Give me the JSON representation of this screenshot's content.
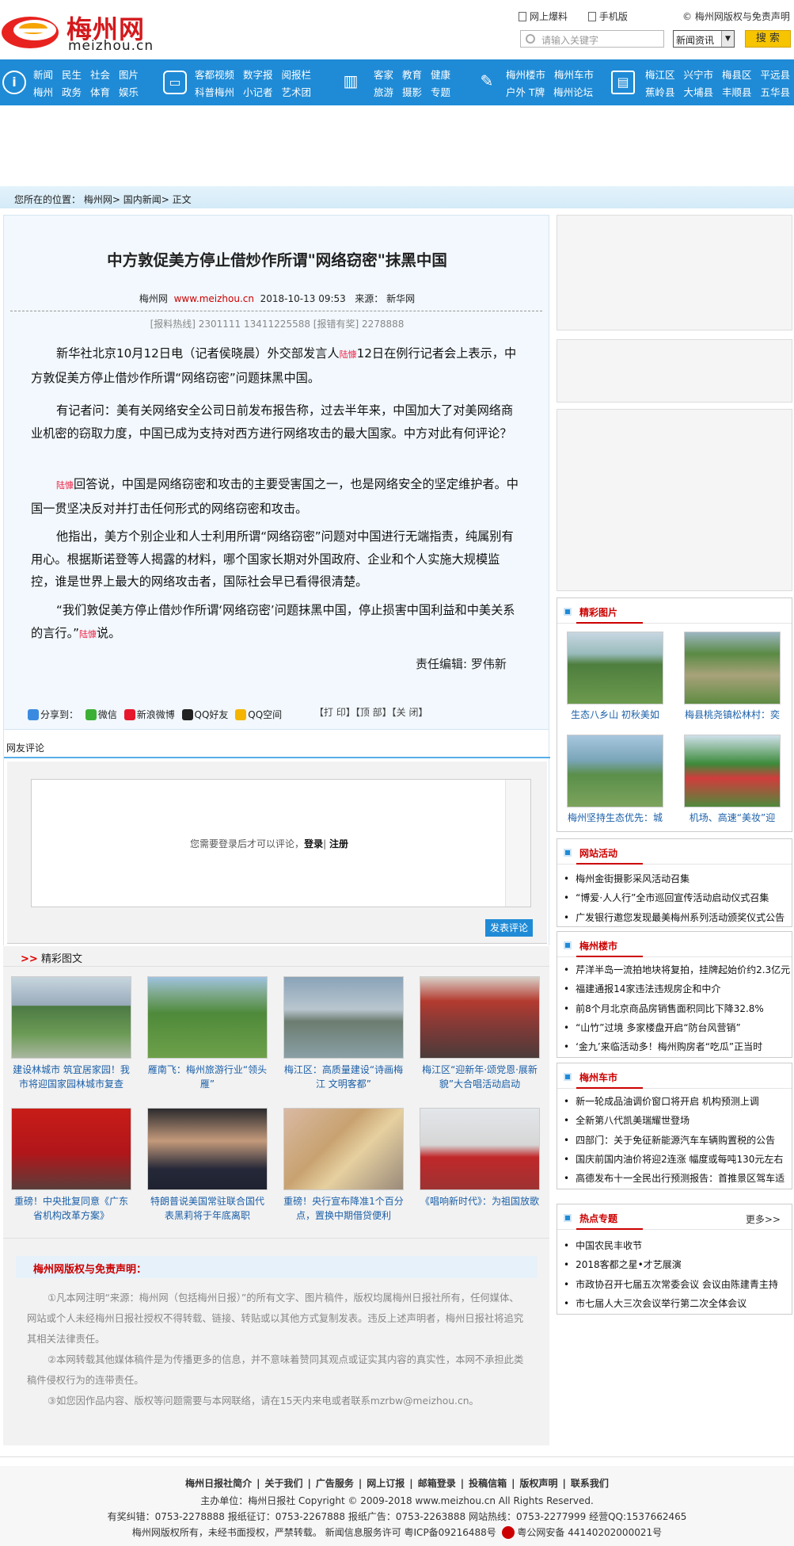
{
  "header": {
    "logo_cn": "梅州网",
    "logo_en": "meizhou.cn",
    "links": [
      "网上爆料",
      "手机版"
    ],
    "copyright_link": "梅州网版权与免责声明",
    "search_placeholder": "请输入关键字",
    "search_category": "新闻资讯",
    "search_button": "搜 索"
  },
  "nav": {
    "group1": {
      "row1": [
        "新闻",
        "民生",
        "社会",
        "图片"
      ],
      "row2": [
        "梅州",
        "政务",
        "体育",
        "娱乐"
      ]
    },
    "group2": {
      "row1": [
        "客都视频",
        "数字报",
        "阅报栏"
      ],
      "row2": [
        "科普梅州",
        "小记者",
        "艺术团"
      ]
    },
    "group3": {
      "row1": [
        "客家",
        "教育",
        "健康"
      ],
      "row2": [
        "旅游",
        "摄影",
        "专题"
      ]
    },
    "group4": {
      "row1": [
        "梅州楼市",
        "梅州车市"
      ],
      "row2": [
        "户外 T牌",
        "梅州论坛"
      ]
    },
    "group5": {
      "row1": [
        "梅江区",
        "兴宁市",
        "梅县区",
        "平远县"
      ],
      "row2": [
        "蕉岭县",
        "大埔县",
        "丰顺县",
        "五华县"
      ]
    }
  },
  "breadcrumb": {
    "prefix": "您所在的位置：",
    "path": "梅州网> 国内新闻> 正文"
  },
  "article": {
    "title": "中方敦促美方停止借炒作所谓\"网络窃密\"抹黑中国",
    "source_site": "梅州网",
    "source_url": "www.meizhou.cn",
    "datetime": "2018-10-13 09:53",
    "source_label": "来源：",
    "source": "新华网",
    "hotline": "[报料热线] 2301111 13411225588 [报错有奖] 2278888",
    "paragraphs": [
      {
        "before": "新华社北京10月12日电（记者侯晓晨）外交部发言人",
        "tag": "陆慷",
        "after": "12日在例行记者会上表示，中方敦促美方停止借炒作所谓“网络窃密”问题抹黑中国。"
      },
      {
        "before": "有记者问：美有关网络安全公司日前发布报告称，过去半年来，中国加大了对美网络商业机密的窃取力度，中国已成为支持对西方进行网络攻击的最大国家。中方对此有何评论？",
        "tag": "",
        "after": ""
      },
      {
        "before": "",
        "tag": "陆慷",
        "after": "回答说，中国是网络窃密和攻击的主要受害国之一，也是网络安全的坚定维护者。中国一贯坚决反对并打击任何形式的网络窃密和攻击。"
      },
      {
        "before": "他指出，美方个别企业和人士利用所谓“网络窃密”问题对中国进行无端指责，纯属别有用心。根据斯诺登等人揭露的材料，哪个国家长期对外国政府、企业和个人实施大规模监控，谁是世界上最大的网络攻击者，国际社会早已看得很清楚。",
        "tag": "",
        "after": ""
      },
      {
        "before": "“我们敦促美方停止借炒作所谓‘网络窃密’问题抹黑中国，停止损害中国利益和中美关系的言行。”",
        "tag": "陆慷",
        "after": "说。"
      }
    ],
    "editor": "责任编辑: 罗伟新",
    "share_label": "分享到：",
    "share": [
      "微信",
      "新浪微博",
      "QQ好友",
      "QQ空间"
    ],
    "actions": "【打 印】【顶 部】【关 闭】"
  },
  "comments": {
    "heading": "网友评论",
    "login_prompt": "您需要登录后才可以评论，",
    "login": "登录",
    "register": "注册",
    "submit": "发表评论"
  },
  "gallery": {
    "heading": "精彩图文",
    "items": [
      "建设林城市 筑宜居家园！我市将迎国家园林城市复查",
      "雁南飞：梅州旅游行业“领头雁”",
      "梅江区：高质量建设“诗画梅江 文明客都”",
      "梅江区“迎新年·颂党恩·展新貌”大合唱活动启动",
      "重磅！中央批复同意《广东省机构改革方案》",
      "特朗普说美国常驻联合国代表黑莉将于年底离职",
      "重磅！央行宣布降准1个百分点，置换中期借贷便利",
      "《唱响新时代》：为祖国放歌"
    ]
  },
  "disclaimer": {
    "heading": "梅州网版权与免责声明：",
    "p1": "①凡本网注明“来源：梅州网（包括梅州日报）”的所有文字、图片稿件，版权均属梅州日报社所有，任何媒体、网站或个人未经梅州日报社授权不得转载、链接、转贴或以其他方式复制发表。违反上述声明者，梅州日报社将追究其相关法律责任。",
    "p2": "②本网转载其他媒体稿件是为传播更多的信息，并不意味着赞同其观点或证实其内容的真实性，本网不承担此类稿件侵权行为的连带责任。",
    "p3": "③如您因作品内容、版权等问题需要与本网联络，请在15天内来电或者联系mzrbw@meizhou.cn。"
  },
  "sidebar": {
    "photos": {
      "heading": "精彩图片",
      "items": [
        "生态八乡山 初秋美如",
        "梅县桃尧镇松林村：奕",
        "梅州坚持生态优先：城",
        "机场、高速“美妆”迎"
      ]
    },
    "activities": {
      "heading": "网站活动",
      "items": [
        "梅州金街摄影采风活动召集",
        "“博爱·人人行”全市巡回宣传活动启动仪式召集",
        "广发银行邀您发现最美梅州系列活动颁奖仪式公告"
      ]
    },
    "property": {
      "heading": "梅州楼市",
      "items": [
        "芹洋半岛一流拍地块将复拍，挂牌起始价约2.3亿元",
        "福建通报14家违法违规房企和中介",
        "前8个月北京商品房销售面积同比下降32.8%",
        "“山竹”过境 多家楼盘开启“防台风营销”",
        "‘金九’来临活动多！梅州购房者“吃瓜”正当时"
      ]
    },
    "cars": {
      "heading": "梅州车市",
      "items": [
        "新一轮成品油调价窗口将开启 机构预测上调",
        "全新第八代凯美瑞耀世登场",
        "四部门：关于免征新能源汽车车辆购置税的公告",
        "国庆前国内油价将迎2连涨 幅度或每吨130元左右",
        "高德发布十一全民出行预测报告：首推景区驾车适"
      ]
    },
    "topics": {
      "heading": "热点专题",
      "more": "更多>>",
      "items": [
        "中国农民丰收节",
        "2018客都之星•才艺展演",
        "市政协召开七届五次常委会议 会议由陈建青主持",
        "市七届人大三次会议举行第二次全体会议"
      ]
    }
  },
  "footer": {
    "links": [
      "梅州日报社简介",
      "关于我们",
      "广告服务",
      "网上订报",
      "邮箱登录",
      "投稿信箱",
      "版权声明",
      "联系我们"
    ],
    "line1": "主办单位：梅州日报社  Copyright © 2009-2018 www.meizhou.cn All Rights Reserved.",
    "line2": "有奖纠错：0753-2278888  报纸征订：0753-2267888  报纸广告：0753-2263888  网站热线：0753-2277999  经营QQ:1537662465",
    "line3": "梅州网版权所有，未经书面授权，严禁转载。  新闻信息服务许可  粤ICP备09216488号",
    "police": "粤公网安备 44140202000021号"
  },
  "colors": {
    "nav_blue": "#1f8bd6",
    "brand_red": "#d3191c",
    "link_blue": "#1a5fa8"
  }
}
